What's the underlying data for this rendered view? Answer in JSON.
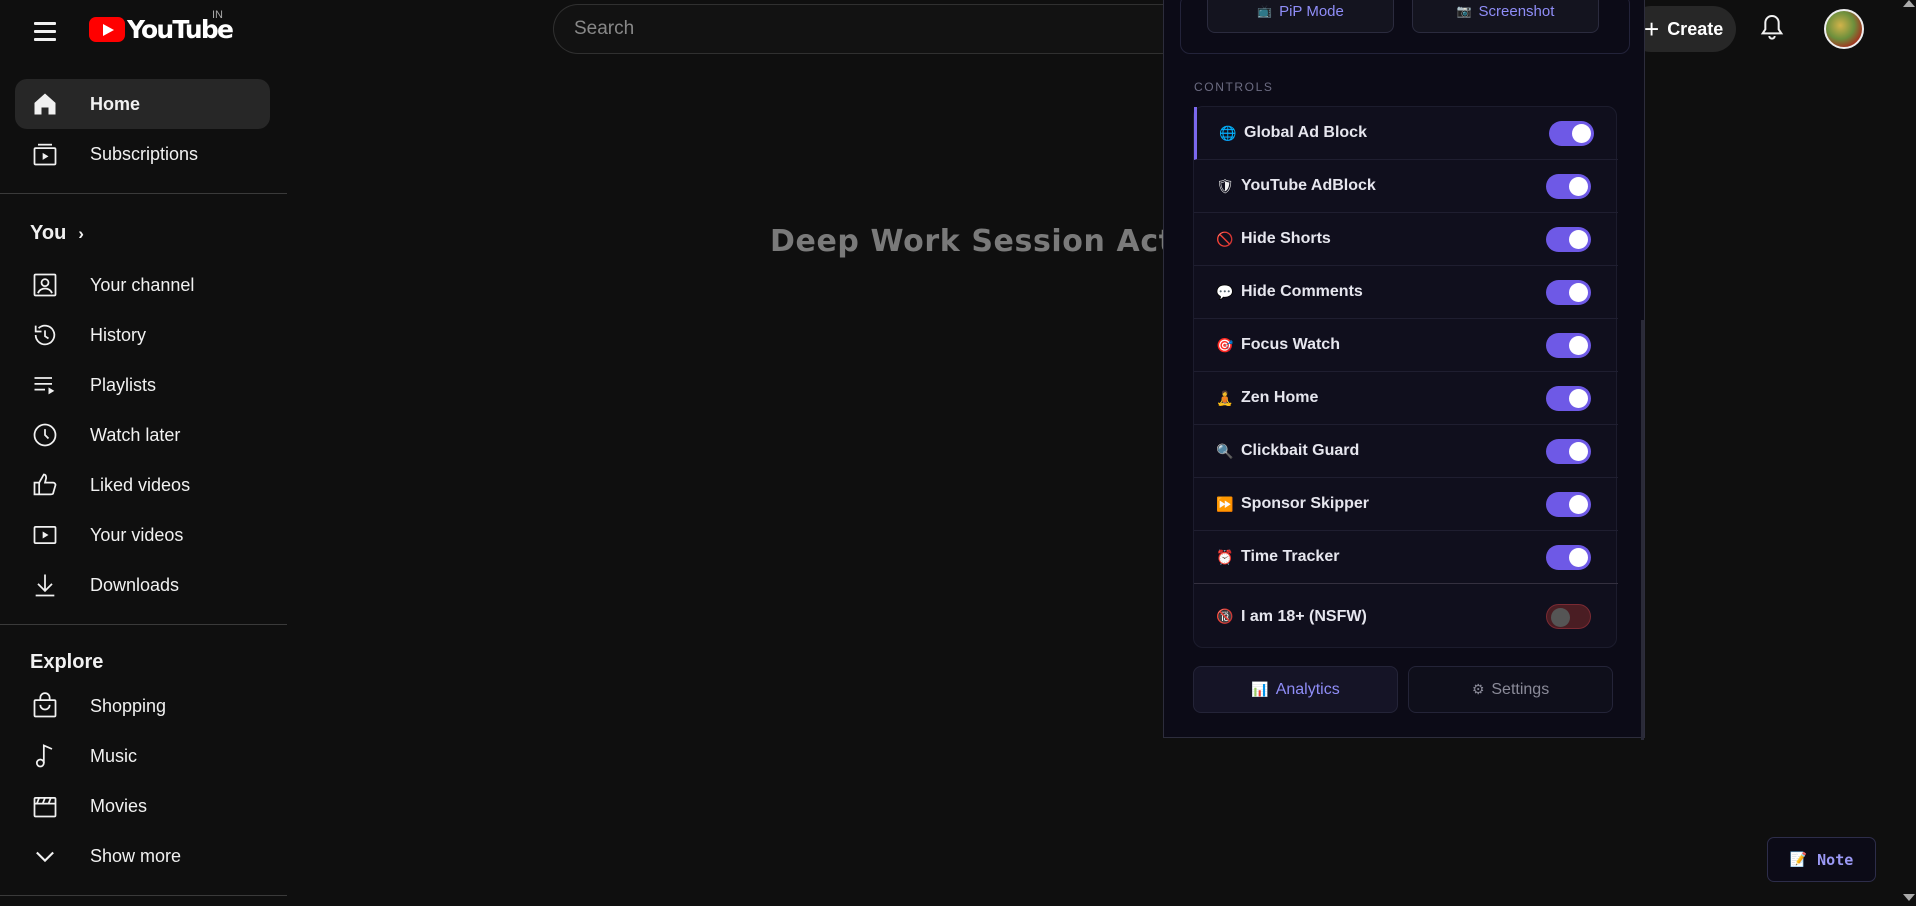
{
  "header": {
    "logo_text": "YouTube",
    "country_code": "IN",
    "search_placeholder": "Search",
    "create_label": "Create"
  },
  "sidebar": {
    "primary": [
      {
        "label": "Home",
        "icon": "home-icon",
        "active": true
      },
      {
        "label": "Subscriptions",
        "icon": "subscriptions-icon"
      }
    ],
    "you_heading": "You",
    "you_items": [
      {
        "label": "Your channel",
        "icon": "channel-icon"
      },
      {
        "label": "History",
        "icon": "history-icon"
      },
      {
        "label": "Playlists",
        "icon": "playlists-icon"
      },
      {
        "label": "Watch later",
        "icon": "clock-icon"
      },
      {
        "label": "Liked videos",
        "icon": "thumbs-up-icon"
      },
      {
        "label": "Your videos",
        "icon": "play-square-icon"
      },
      {
        "label": "Downloads",
        "icon": "download-icon"
      }
    ],
    "explore_heading": "Explore",
    "explore_items": [
      {
        "label": "Shopping",
        "icon": "shopping-bag-icon"
      },
      {
        "label": "Music",
        "icon": "music-note-icon"
      },
      {
        "label": "Movies",
        "icon": "clapperboard-icon"
      },
      {
        "label": "Show more",
        "icon": "chevron-down-icon"
      }
    ]
  },
  "main": {
    "message": "Deep Work Session Active."
  },
  "extension": {
    "pip_label": "PiP Mode",
    "screenshot_label": "Screenshot",
    "controls_heading": "CONTROLS",
    "controls": [
      {
        "label": "Global Ad Block",
        "emoji": "🌐",
        "on": true
      },
      {
        "label": "YouTube AdBlock",
        "emoji": "🛡",
        "on": true
      },
      {
        "label": "Hide Shorts",
        "emoji": "🚫",
        "on": true
      },
      {
        "label": "Hide Comments",
        "emoji": "💬",
        "on": true
      },
      {
        "label": "Focus Watch",
        "emoji": "🎯",
        "on": true
      },
      {
        "label": "Zen Home",
        "emoji": "🧘",
        "on": true
      },
      {
        "label": "Clickbait Guard",
        "emoji": "🔍",
        "on": true
      },
      {
        "label": "Sponsor Skipper",
        "emoji": "⏩",
        "on": true
      },
      {
        "label": "Time Tracker",
        "emoji": "⏰",
        "on": true
      },
      {
        "label": "I am 18+ (NSFW)",
        "emoji": "🔞",
        "on": false
      }
    ],
    "analytics_label": "Analytics",
    "settings_label": "Settings"
  },
  "note_label": "Note"
}
